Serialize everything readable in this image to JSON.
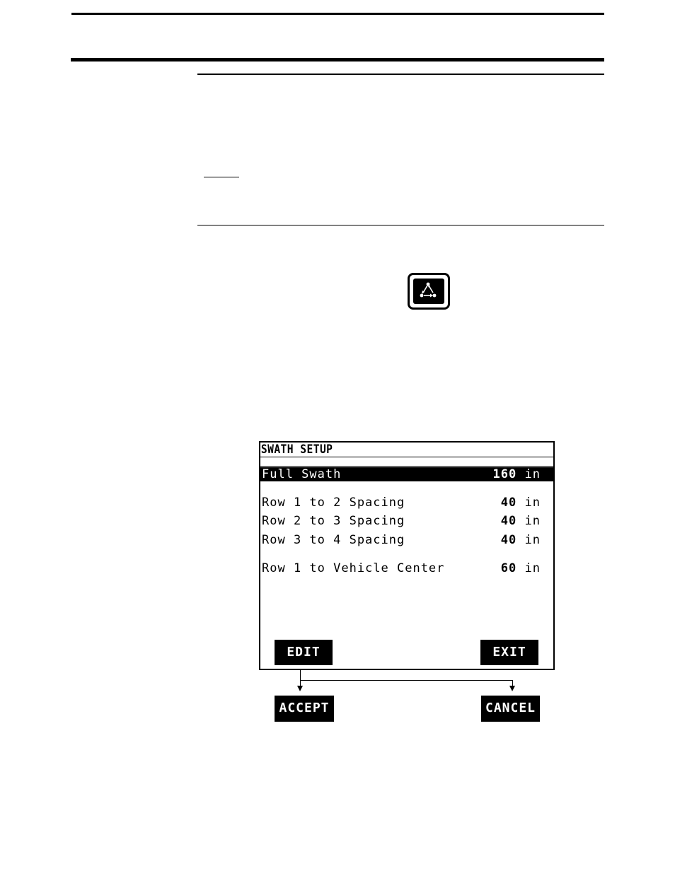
{
  "page": {
    "icon": "swath-setup-triangle-icon"
  },
  "screen": {
    "title": "SWATH SETUP",
    "rows": [
      {
        "label": "Full Swath",
        "value": "160",
        "unit": "in",
        "selected": true
      },
      {
        "label": "Row 1 to 2 Spacing",
        "value": "40",
        "unit": "in",
        "selected": false
      },
      {
        "label": "Row 2 to 3 Spacing",
        "value": "40",
        "unit": "in",
        "selected": false
      },
      {
        "label": "Row 3 to 4 Spacing",
        "value": "40",
        "unit": "in",
        "selected": false
      },
      {
        "label": "Row 1 to Vehicle Center",
        "value": "60",
        "unit": "in",
        "selected": false
      }
    ],
    "softkeys": {
      "edit": "EDIT",
      "exit": "EXIT"
    }
  },
  "edit_mode_softkeys": {
    "accept": "ACCEPT",
    "cancel": "CANCEL"
  },
  "colors": {
    "ink": "#000000",
    "paper": "#ffffff"
  }
}
